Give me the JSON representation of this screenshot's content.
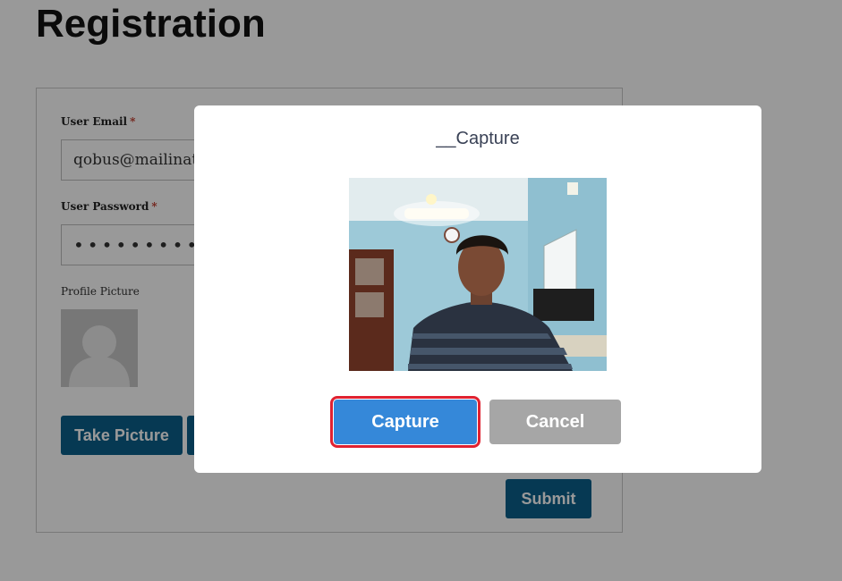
{
  "page": {
    "title": "Registration"
  },
  "form": {
    "email_label": "User Email",
    "email_required": "*",
    "email_value": "qobus@mailinato",
    "password_label": "User Password",
    "password_required": "*",
    "password_value": "•••••••••",
    "profile_picture_label": "Profile Picture",
    "take_picture_label": "Take Picture",
    "submit_label": "Submit"
  },
  "modal": {
    "title": "__Capture",
    "capture_label": "Capture",
    "cancel_label": "Cancel"
  },
  "colors": {
    "primary_button": "#0b5f8a",
    "capture_button": "#3588d9",
    "cancel_button": "#a6a6a6",
    "highlight_outline": "#e02231"
  }
}
